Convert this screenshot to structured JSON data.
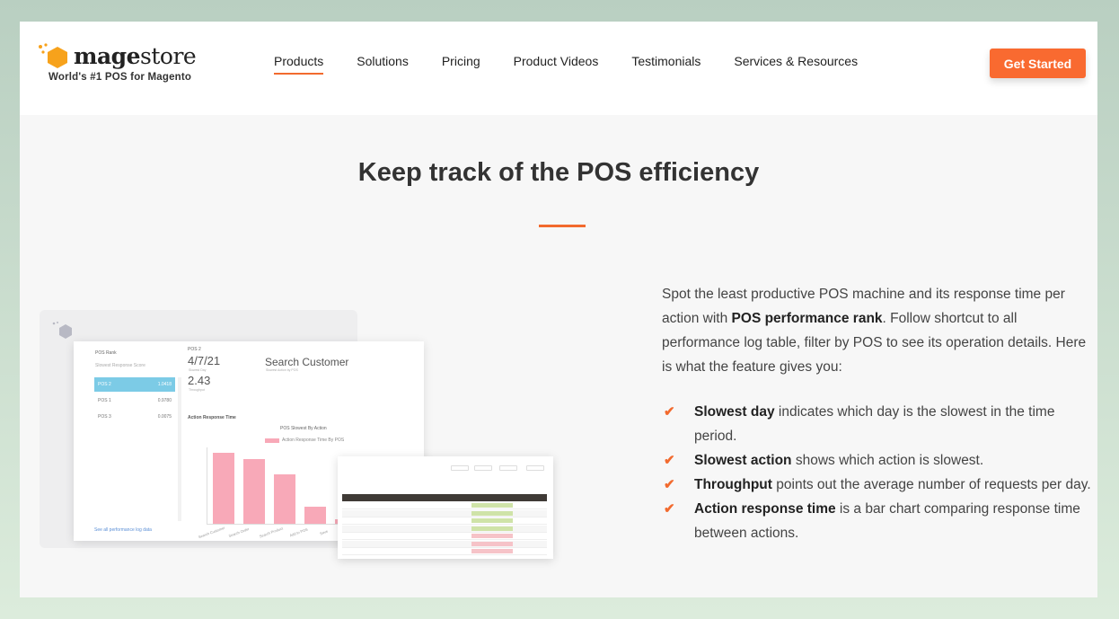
{
  "header": {
    "logo": {
      "name_bold": "mage",
      "name_rest": "store",
      "tagline": "World's #1 POS for Magento"
    },
    "nav": [
      {
        "label": "Products",
        "active": true
      },
      {
        "label": "Solutions"
      },
      {
        "label": "Pricing"
      },
      {
        "label": "Product Videos"
      },
      {
        "label": "Testimonials"
      },
      {
        "label": "Services & Resources"
      }
    ],
    "cta_label": "Get Started"
  },
  "colors": {
    "accent": "#f26a2e",
    "cta": "#f96a30",
    "bar": "#f8a9b8",
    "selected_row": "#7ccbe6"
  },
  "section": {
    "title": "Keep track of the POS efficiency",
    "desc_1": "Spot the least productive POS machine and its response time per action with ",
    "desc_bold": "POS performance rank",
    "desc_2": ". Follow shortcut to all performance log table, filter by POS to see its operation details. Here is what the feature gives you:",
    "features": [
      {
        "icon": "check-icon",
        "bold": "Slowest day",
        "text": " indicates which day is the slowest in the time period."
      },
      {
        "icon": "check-icon",
        "bold": "Slowest action",
        "text": " shows which action is slowest."
      },
      {
        "icon": "check-icon",
        "bold": "Throughput",
        "text": " points out the average number of requests per day."
      },
      {
        "icon": "check-icon",
        "bold": "Action response time",
        "text": " is a bar chart comparing response time between actions."
      }
    ]
  },
  "mockup": {
    "rank_title": "POS Rank",
    "rank_sub": "Slowest Response Score",
    "rows": [
      {
        "name": "POS 2",
        "value": "1.0418"
      },
      {
        "name": "POS 1",
        "value": "0.9780"
      },
      {
        "name": "POS 3",
        "value": "0.0075"
      }
    ],
    "link": "See all performance log data",
    "pos_label": "POS 2",
    "slowest_day": "4/7/21",
    "slowest_day_sub": "Slowest Day",
    "throughput": "2.43",
    "throughput_sub": "Throughput",
    "slowest_action": "Search Customer",
    "slowest_action_sub": "Slowest Action by POS",
    "chart_title": "Action Response Time",
    "chart_caption": "POS Slowest By Action",
    "legend": "Action Response Time By POS",
    "bars": [
      {
        "label": "Search Customer",
        "value": 0.92
      },
      {
        "label": "Search Order",
        "value": 0.84
      },
      {
        "label": "Search Product",
        "value": 0.64
      },
      {
        "label": "Add to POS",
        "value": 0.22
      },
      {
        "label": "Save",
        "value": 0.06
      }
    ]
  }
}
